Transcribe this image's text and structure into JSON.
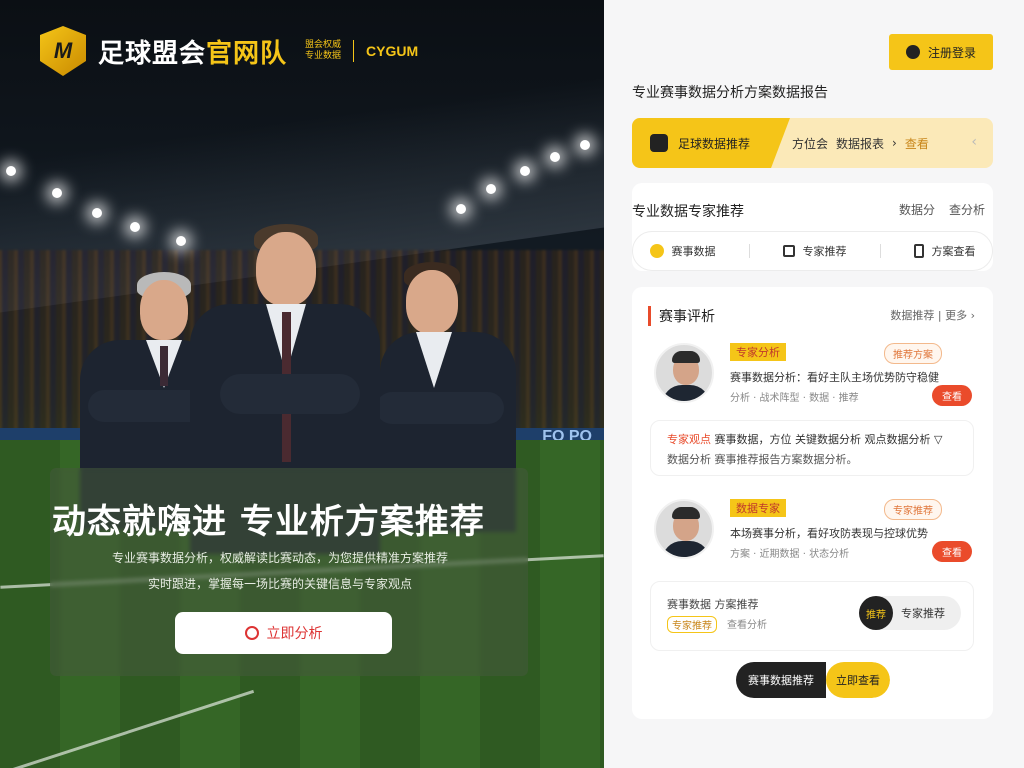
{
  "brand": {
    "title_white": "足球盟会",
    "title_yellow": "官网队",
    "small_line1": "盟会权威",
    "small_line2": "专业数据",
    "en": "CYGUM"
  },
  "hero": {
    "headline": "动态就嗨进 专业析方案推荐",
    "desc_line1": "专业赛事数据分析，权威解读比赛动态，为您提供精准方案推荐",
    "desc_line2": "实时跟进，掌握每一场比赛的关键信息与专家观点",
    "cta": "立即分析"
  },
  "board_text": "FO PO",
  "top_button": "注册登录",
  "subtitle": "专业赛事数据分析方案数据报告",
  "tabs": {
    "active": "足球数据推荐",
    "crumb1": "方位会",
    "crumb2": "数据报表",
    "crumb3": "查看"
  },
  "card1": {
    "title": "专业数据专家推荐",
    "link1": "数据分",
    "link2": "查分析",
    "items": [
      "赛事数据",
      "专家推荐",
      "方案查看"
    ]
  },
  "card2": {
    "title": "赛事评析",
    "links": "数据推荐 | 更多 ›"
  },
  "experts": [
    {
      "name": "专家分析",
      "tag": "推荐方案",
      "line1": "赛事数据分析：看好主队主场优势防守稳健",
      "line2": "分析 · 战术阵型 · 数据 · 推荐",
      "action": "查看"
    },
    {
      "name": "数据专家",
      "tag": "专家推荐",
      "line1": "本场赛事分析，看好攻防表现与控球优势",
      "line2": "方案 · 近期数据 · 状态分析",
      "action": "查看"
    }
  ],
  "quote": {
    "red": "专家观点",
    "line1_rest": "赛事数据，方位 关键数据分析 观点数据分析 ▽",
    "line2": "数据分析 赛事推荐报告方案数据分析。"
  },
  "stats": {
    "line1": "赛事数据  方案推荐",
    "badge": "专家推荐",
    "extra": "查看分析",
    "pill_dark": "推荐",
    "pill_label": "专家推荐"
  },
  "toggle": {
    "left": "赛事数据推荐",
    "right": "立即查看"
  },
  "colors": {
    "accent": "#f5c518",
    "red": "#ea4b2b"
  }
}
